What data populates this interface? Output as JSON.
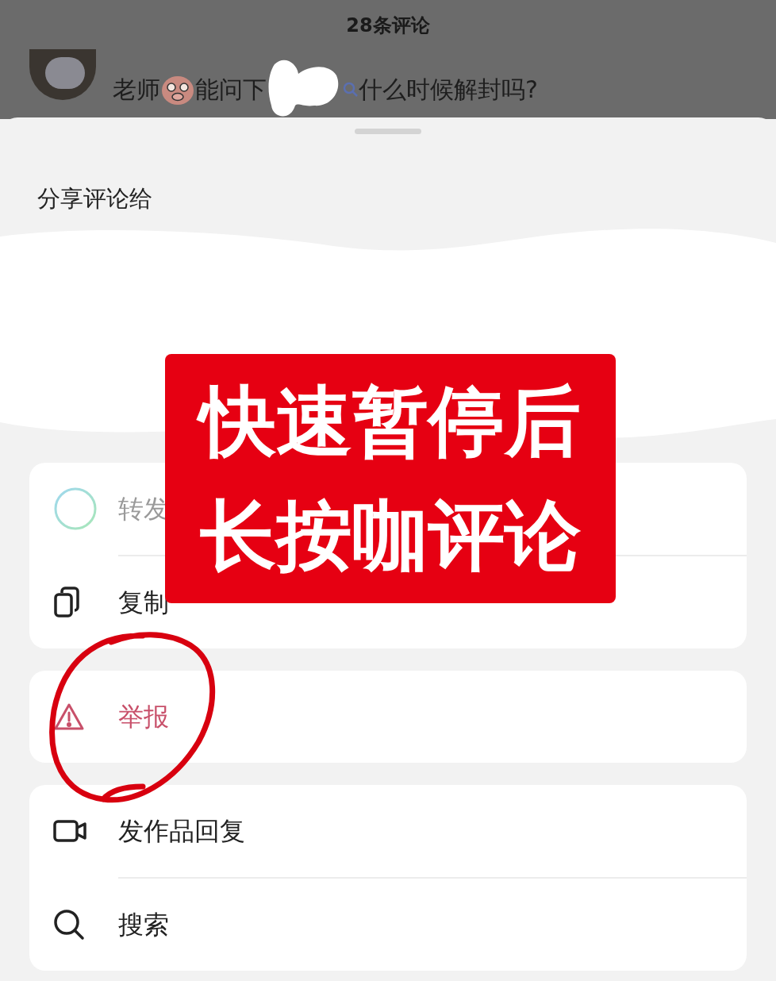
{
  "header": {
    "title": "28条评论"
  },
  "comment": {
    "parts": [
      "老师",
      "能问下",
      "什么时候解封吗?"
    ]
  },
  "sheet": {
    "title": "分享评论给",
    "groups": [
      {
        "items": [
          {
            "kind": "forward",
            "label": "转发"
          },
          {
            "kind": "copy",
            "label": "复制"
          }
        ]
      },
      {
        "items": [
          {
            "kind": "report",
            "label": "举报"
          }
        ]
      },
      {
        "items": [
          {
            "kind": "video",
            "label": "发作品回复"
          },
          {
            "kind": "search",
            "label": "搜索"
          }
        ]
      }
    ]
  },
  "overlay": {
    "lines": [
      "快速暂停后",
      "长按咖评论"
    ]
  }
}
